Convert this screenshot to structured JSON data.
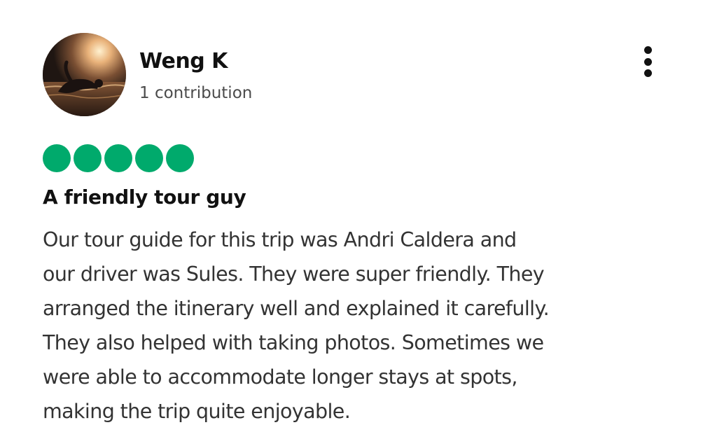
{
  "review": {
    "author": {
      "name": "Weng K",
      "contributions": "1 contribution",
      "avatar_icon": "swimmer-sunset-avatar"
    },
    "menu_icon": "more-vertical-icon",
    "rating": {
      "value": 5,
      "max": 5,
      "color": "#00aa6c"
    },
    "title": "A friendly tour guy",
    "body_lines": [
      "Our tour guide for this trip was Andri Caldera and",
      "our driver was Sules. They were super friendly. They",
      "arranged the itinerary well and explained it carefully.",
      "They also helped with taking photos. Sometimes we",
      "were able to accommodate longer stays at spots,",
      "making the trip quite enjoyable."
    ]
  }
}
